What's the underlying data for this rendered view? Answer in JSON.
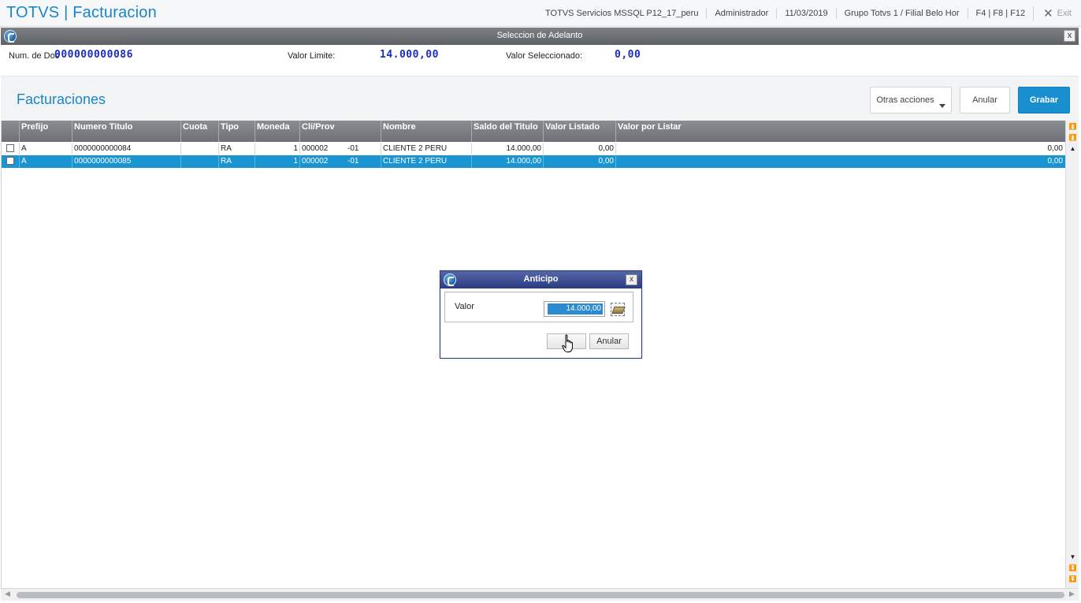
{
  "app": {
    "title": "TOTVS | Facturacion",
    "server": "TOTVS Servicios MSSQL P12_17_peru",
    "user": "Administrador",
    "date": "11/03/2019",
    "branch": "Grupo Totvs 1 / Filial Belo Hor",
    "shortcuts": "F4 | F8 | F12",
    "exit_label": "Exit"
  },
  "window": {
    "title": "Seleccion de Adelanto",
    "close_label": "x"
  },
  "header": {
    "doc_label": "Num. de Doc",
    "doc_value": "000000000086",
    "limit_label": "Valor Limite:",
    "limit_value": "14.000,00",
    "selected_label": "Valor Seleccionado:",
    "selected_value": "0,00"
  },
  "section": {
    "title": "Facturaciones",
    "other_actions": "Otras acciones",
    "cancel": "Anular",
    "save": "Grabar"
  },
  "grid": {
    "columns": [
      "Prefijo",
      "Numero Titulo",
      "Cuota",
      "Tipo",
      "Moneda",
      "Cli/Prov",
      "Nombre",
      "Saldo del Titulo",
      "Valor Listado",
      "Valor por Listar"
    ],
    "rows": [
      {
        "prefijo": "A",
        "numero": "0000000000084",
        "cuota": "",
        "tipo": "RA",
        "moneda": "1",
        "cliprov": "000002",
        "tienda": "-01",
        "nombre": "CLIENTE 2 PERU",
        "saldo": "14.000,00",
        "listado": "0,00",
        "por_listar": "0,00",
        "selected": false
      },
      {
        "prefijo": "A",
        "numero": "0000000000085",
        "cuota": "",
        "tipo": "RA",
        "moneda": "1",
        "cliprov": "000002",
        "tienda": "-01",
        "nombre": "CLIENTE 2 PERU",
        "saldo": "14.000,00",
        "listado": "0,00",
        "por_listar": "0,00",
        "selected": true
      }
    ]
  },
  "dialog": {
    "title": "Anticipo",
    "close_label": "x",
    "field_label": "Valor",
    "field_value": "14.000,00",
    "ok_label": "",
    "cancel_label": "Anular"
  },
  "colors": {
    "accent": "#1a86c8",
    "primary_button": "#1a8fcf",
    "selected_row": "#1a95d1",
    "value_blue": "#1a2cc2",
    "dialog_title": "#2c3c80"
  },
  "icons": [
    "totvs-logo-icon",
    "close-icon",
    "exit-icon",
    "chevron-down-icon",
    "lookup-icon",
    "scroll-top-icon",
    "scroll-up-icon",
    "scroll-down-icon",
    "scroll-bottom-icon",
    "hand-cursor-icon"
  ]
}
